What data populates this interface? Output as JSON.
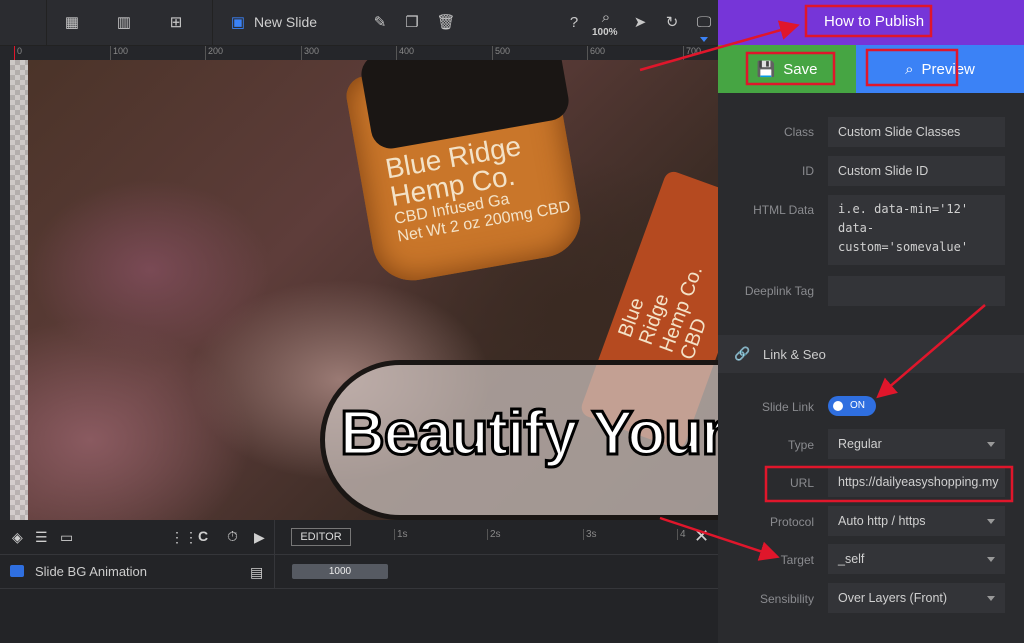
{
  "toolbar": {
    "slide_name": "New Slide",
    "zoom": "100%",
    "icons": [
      "grid-icon",
      "slides-icon",
      "add-slide-icon",
      "slide-icon",
      "edit-icon",
      "duplicate-icon",
      "delete-icon",
      "help-icon",
      "zoom-icon",
      "cursor-icon",
      "undo-icon",
      "desktop-icon"
    ]
  },
  "ruler": {
    "ticks": [
      "0",
      "100",
      "200",
      "300",
      "400",
      "500",
      "600",
      "700"
    ]
  },
  "canvas": {
    "headline": "Beautify Yours",
    "jar_label": [
      "Blue Ridge",
      "Hemp Co.",
      "CBD Infused Ga",
      "Net Wt 2 oz 200mg CBD"
    ],
    "bottle_label": [
      "Blue Ridge",
      "Hemp Co.",
      "CBD"
    ]
  },
  "timeline": {
    "editor_label": "EDITOR",
    "ticks": [
      "1s",
      "2s",
      "3s",
      "4"
    ],
    "layer_name": "Slide BG Animation",
    "duration": "1000"
  },
  "right": {
    "publish_label": "How to Publish",
    "save_label": "Save",
    "preview_label": "Preview",
    "fields": {
      "class": {
        "label": "Class",
        "value": "Custom Slide Classes"
      },
      "id": {
        "label": "ID",
        "value": "Custom Slide ID"
      },
      "html_data": {
        "label": "HTML Data",
        "value": "i.e. data-min='12' data-custom='somevalue'"
      },
      "deeplink": {
        "label": "Deeplink Tag",
        "value": ""
      }
    },
    "section_title": "Link & Seo",
    "link": {
      "slide_link": {
        "label": "Slide Link",
        "value": "ON"
      },
      "type": {
        "label": "Type",
        "value": "Regular"
      },
      "url": {
        "label": "URL",
        "value": "https://dailyeasyshopping.my"
      },
      "protocol": {
        "label": "Protocol",
        "value": "Auto http / https"
      },
      "target": {
        "label": "Target",
        "value": "_self"
      },
      "sensibility": {
        "label": "Sensibility",
        "value": "Over Layers (Front)"
      }
    }
  },
  "colors": {
    "publish": "#7635d8",
    "save": "#46a543",
    "preview": "#3b82f6",
    "toggle": "#2f6fe0",
    "annotation": "#e0162b"
  }
}
